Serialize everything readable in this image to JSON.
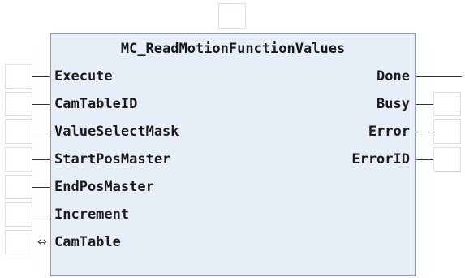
{
  "block": {
    "name": "MC_ReadMotionFunctionValues",
    "inputs": [
      {
        "label": "Execute"
      },
      {
        "label": "CamTableID"
      },
      {
        "label": "ValueSelectMask"
      },
      {
        "label": "StartPosMaster"
      },
      {
        "label": "EndPosMaster"
      },
      {
        "label": "Increment"
      }
    ],
    "inout": {
      "label": "CamTable",
      "icon": "bidirectional-arrow-icon",
      "glyph": "⇔"
    },
    "outputs": [
      {
        "label": "Done"
      },
      {
        "label": "Busy"
      },
      {
        "label": "Error"
      },
      {
        "label": "ErrorID"
      }
    ]
  }
}
